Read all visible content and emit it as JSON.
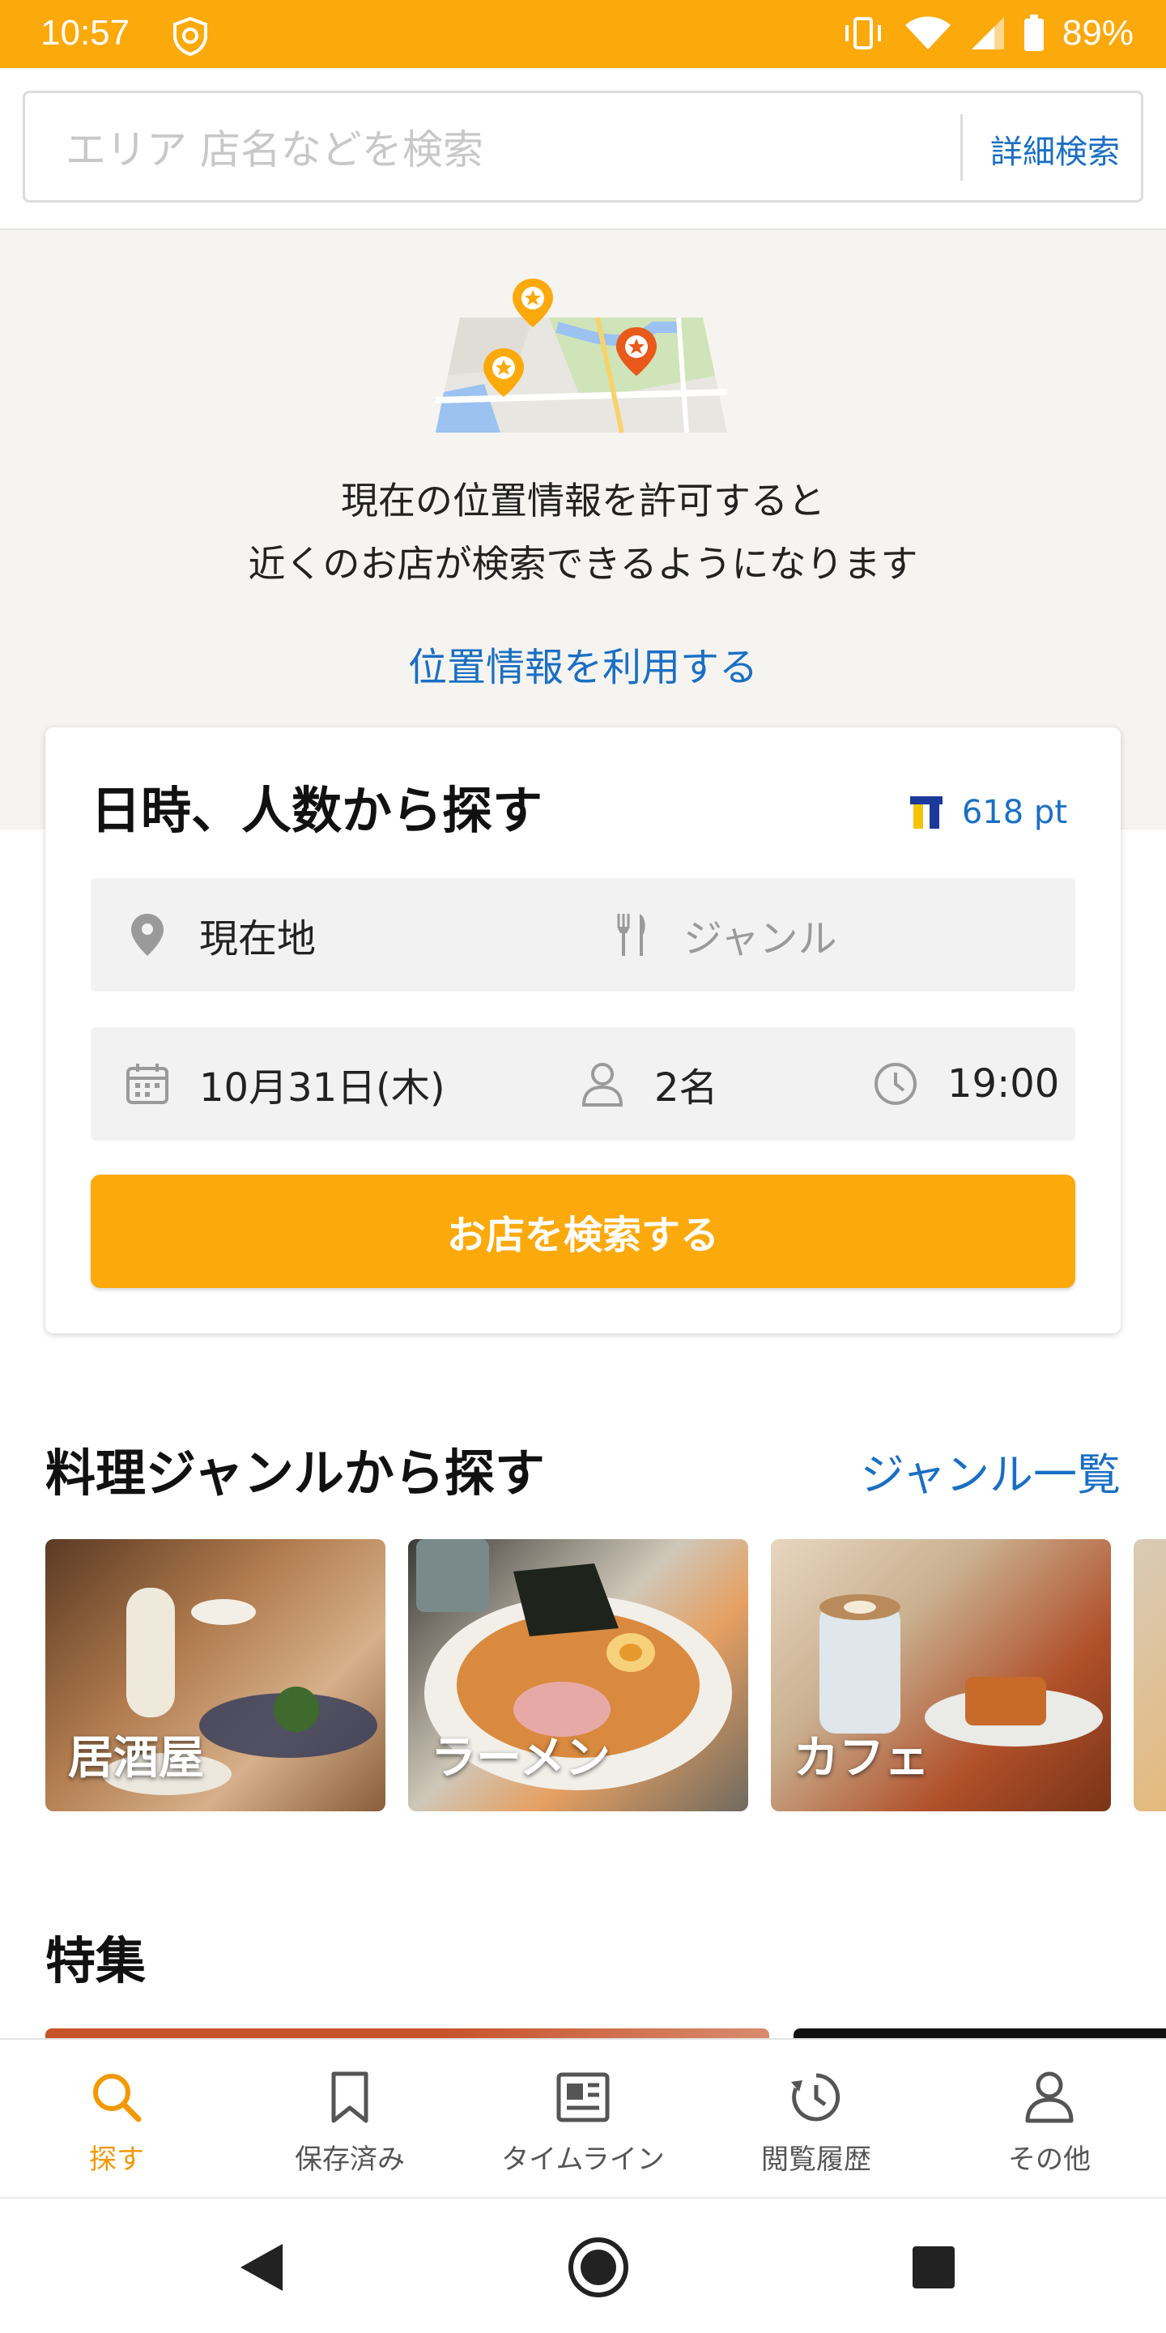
{
  "status_bar": {
    "time": "10:57",
    "battery": "89%",
    "icons": [
      "shield-icon",
      "vibrate-icon",
      "wifi-icon",
      "signal-icon",
      "battery-icon"
    ]
  },
  "search": {
    "placeholder": "エリア 店名などを検索",
    "detail_label": "詳細検索"
  },
  "location": {
    "message_line1": "現在の位置情報を許可すると",
    "message_line2": "近くのお店が検索できるようになります",
    "use_location_label": "位置情報を利用する"
  },
  "reservation_card": {
    "title": "日時、人数から探す",
    "points": "618 pt",
    "place_value": "現在地",
    "genre_placeholder": "ジャンル",
    "date_value": "10月31日(木)",
    "people_value": "2名",
    "time_value": "19:00",
    "search_button_label": "お店を検索する"
  },
  "genre_section": {
    "title": "料理ジャンルから探す",
    "all_link": "ジャンル一覧",
    "tiles": [
      {
        "label": "居酒屋"
      },
      {
        "label": "ラーメン"
      },
      {
        "label": "カフェ"
      }
    ]
  },
  "feature_section": {
    "title": "特集"
  },
  "bottom_nav": {
    "items": [
      {
        "label": "探す",
        "icon": "search-icon",
        "active": true
      },
      {
        "label": "保存済み",
        "icon": "bookmark-icon",
        "active": false
      },
      {
        "label": "タイムライン",
        "icon": "timeline-icon",
        "active": false
      },
      {
        "label": "閲覧履歴",
        "icon": "history-icon",
        "active": false
      },
      {
        "label": "その他",
        "icon": "person-icon",
        "active": false
      }
    ]
  },
  "colors": {
    "brand_orange": "#fca90c",
    "link_blue": "#1a6fc4",
    "active_nav": "#f39800"
  }
}
